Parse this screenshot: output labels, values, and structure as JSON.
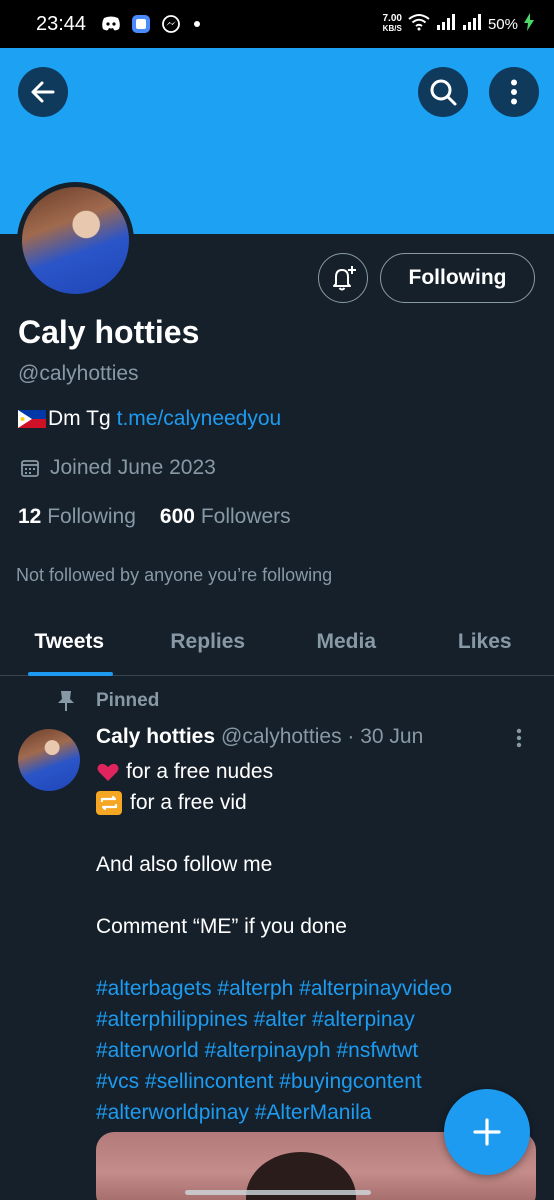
{
  "status_bar": {
    "time": "23:44",
    "net_speed_value": "7.00",
    "net_speed_unit": "KB/S",
    "battery": "50%"
  },
  "header": {
    "back_icon": "arrow-left-icon",
    "search_icon": "search-icon",
    "more_icon": "more-vertical-icon",
    "banner_color": "#1da1f2"
  },
  "profile": {
    "name": "Caly hotties",
    "handle": "@calyhotties",
    "bio_text": "Dm Tg",
    "bio_link": "t.me/calyneedyou",
    "joined": "Joined June 2023",
    "following_count": "12",
    "following_label": "Following",
    "followers_count": "600",
    "followers_label": "Followers",
    "not_followed": "Not followed by anyone you’re following",
    "follow_button": "Following"
  },
  "tabs": [
    {
      "label": "Tweets",
      "active": true
    },
    {
      "label": "Replies",
      "active": false
    },
    {
      "label": "Media",
      "active": false
    },
    {
      "label": "Likes",
      "active": false
    }
  ],
  "tweet": {
    "pinned_label": "Pinned",
    "author_name": "Caly hotties",
    "author_meta": "@calyhotties · 30 Jun",
    "line1": "for a free nudes",
    "line2": "for a free vid",
    "line3": "And also follow me",
    "line4": "Comment “ME” if you done",
    "tags1": "#alterbagets #alterph #alterpinayvideo",
    "tags2": "#alterphilippines #alter #alterpinay",
    "tags3": "#alterworld #alterpinayph #nsfwtwt",
    "tags4": "#vcs #sellincontent #buyingcontent",
    "tags5": "#alterworldpinay #AlterManila"
  },
  "colors": {
    "background": "#15202b",
    "accent": "#1d9bf0",
    "secondary_text": "#8899a6"
  }
}
